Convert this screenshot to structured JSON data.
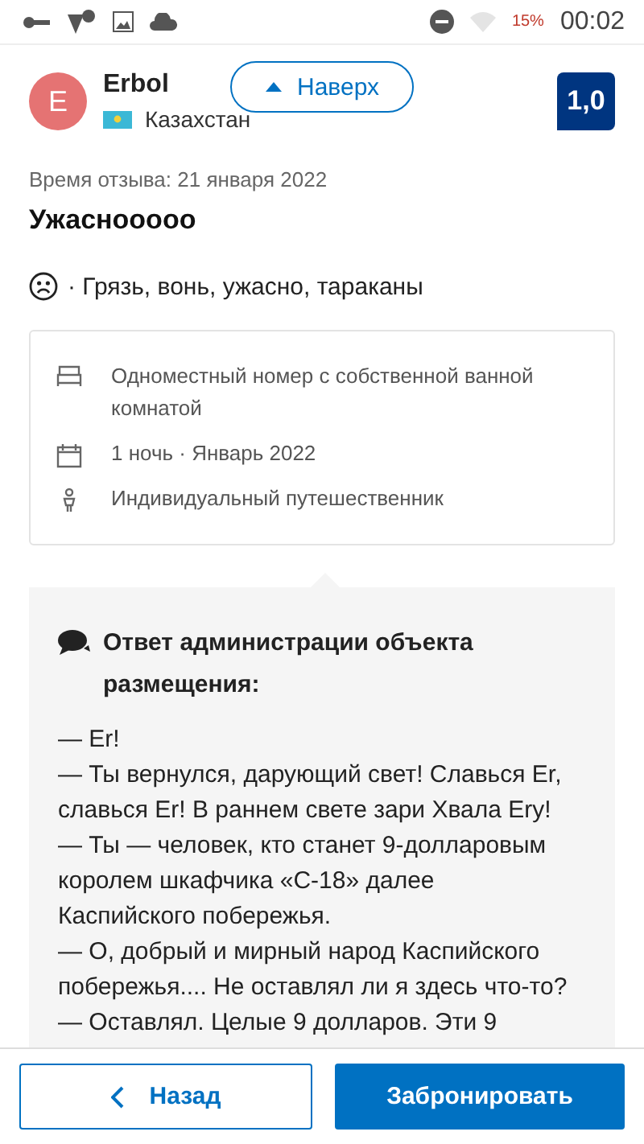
{
  "status_bar": {
    "battery": "15%",
    "time": "00:02"
  },
  "reviewer": {
    "initial": "E",
    "name": "Erbol",
    "country": "Казахстан"
  },
  "score": "1,0",
  "scroll_top_button": "Наверх",
  "review": {
    "date": "Время отзыва: 21 января 2022",
    "title": "Ужаснооооо",
    "negative": "· Грязь, вонь, ужасно, тараканы"
  },
  "stay_details": [
    {
      "kind": "room",
      "text": "Одноместный номер с собственной ванной комнатой"
    },
    {
      "kind": "dates",
      "text": "1 ночь · Январь 2022"
    },
    {
      "kind": "traveler",
      "text": "Индивидуальный путешественник"
    }
  ],
  "response": {
    "title": "Ответ администрации объекта размещения:",
    "lines": [
      "— Er!",
      "— Ты вернулся, дарующий свет! Славься Er, славься Er! В раннем свете зари Хвала Ery!",
      "— Ты — человек, кто станет 9-долларовым королем шкафчика «С-18» далее Каспийского побережья.",
      "— О, добрый и мирный народ Каспийского побережья.... Не оставлял ли я здесь что-то?",
      "— Оставлял. Целые 9 долларов. Эти 9"
    ]
  },
  "footer": {
    "back": "Назад",
    "book": "Забронировать"
  }
}
